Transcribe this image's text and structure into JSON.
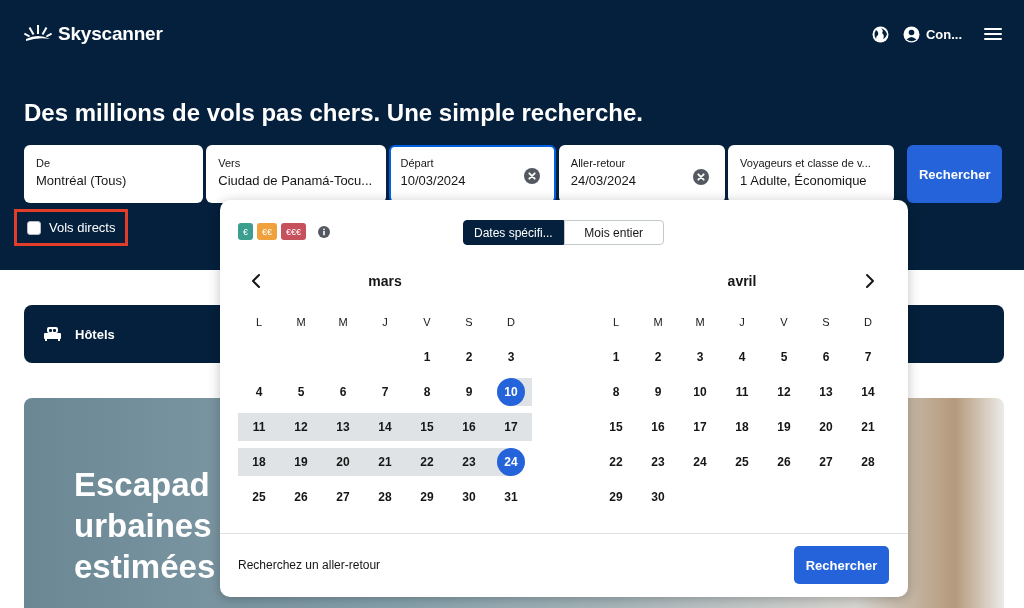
{
  "header": {
    "logo": "Skyscanner",
    "account_label": "Con...",
    "headline": "Des millions de vols pas chers. Une simple recherche."
  },
  "search_fields": [
    {
      "label": "De",
      "value": "Montréal (Tous)",
      "clearable": false,
      "focused": false
    },
    {
      "label": "Vers",
      "value": "Ciudad de Panamá-Tocu...",
      "clearable": false,
      "focused": false
    },
    {
      "label": "Départ",
      "value": "10/03/2024",
      "clearable": true,
      "focused": true
    },
    {
      "label": "Aller-retour",
      "value": "24/03/2024",
      "clearable": true,
      "focused": false
    },
    {
      "label": "Voyageurs et classe de v...",
      "value": "1 Adulte, Économique",
      "clearable": false,
      "focused": false
    }
  ],
  "search_button": "Rechercher",
  "direct_flights": {
    "label": "Vols directs",
    "checked": false,
    "highlighted": true
  },
  "date_picker": {
    "price_legend": [
      {
        "label": "€",
        "color": "#3b9e8f"
      },
      {
        "label": "€€",
        "color": "#f0a13c"
      },
      {
        "label": "€€€",
        "color": "#c7505d"
      }
    ],
    "modes": [
      {
        "label": "Dates spécifi...",
        "selected": true
      },
      {
        "label": "Mois entier",
        "selected": false
      }
    ],
    "months": [
      {
        "name": "mars",
        "prev_arrow": true,
        "next_arrow": false,
        "weekdays": [
          "L",
          "M",
          "M",
          "J",
          "V",
          "S",
          "D"
        ],
        "weeks": [
          {
            "kind": "tail",
            "days": [
              {
                "label": "1",
                "selected": false,
                "in_range": false
              },
              {
                "label": "2",
                "selected": false,
                "in_range": false
              },
              {
                "label": "3",
                "selected": false,
                "in_range": false
              }
            ]
          },
          {
            "kind": "full",
            "days": [
              {
                "label": "4",
                "selected": false,
                "in_range": false
              },
              {
                "label": "5",
                "selected": false,
                "in_range": false
              },
              {
                "label": "6",
                "selected": false,
                "in_range": false
              },
              {
                "label": "7",
                "selected": false,
                "in_range": false
              },
              {
                "label": "8",
                "selected": false,
                "in_range": false
              },
              {
                "label": "9",
                "selected": false,
                "in_range": false
              },
              {
                "label": "10",
                "selected": true,
                "in_range": false
              }
            ]
          },
          {
            "kind": "full",
            "days": [
              {
                "label": "11",
                "selected": false,
                "in_range": true
              },
              {
                "label": "12",
                "selected": false,
                "in_range": true
              },
              {
                "label": "13",
                "selected": false,
                "in_range": true
              },
              {
                "label": "14",
                "selected": false,
                "in_range": true
              },
              {
                "label": "15",
                "selected": false,
                "in_range": true
              },
              {
                "label": "16",
                "selected": false,
                "in_range": true
              },
              {
                "label": "17",
                "selected": false,
                "in_range": true
              }
            ]
          },
          {
            "kind": "full",
            "days": [
              {
                "label": "18",
                "selected": false,
                "in_range": true
              },
              {
                "label": "19",
                "selected": false,
                "in_range": true
              },
              {
                "label": "20",
                "selected": false,
                "in_range": true
              },
              {
                "label": "21",
                "selected": false,
                "in_range": true
              },
              {
                "label": "22",
                "selected": false,
                "in_range": true
              },
              {
                "label": "23",
                "selected": false,
                "in_range": true
              },
              {
                "label": "24",
                "selected": true,
                "in_range": false
              }
            ]
          },
          {
            "kind": "full",
            "days": [
              {
                "label": "25",
                "selected": false,
                "in_range": false
              },
              {
                "label": "26",
                "selected": false,
                "in_range": false
              },
              {
                "label": "27",
                "selected": false,
                "in_range": false
              },
              {
                "label": "28",
                "selected": false,
                "in_range": false
              },
              {
                "label": "29",
                "selected": false,
                "in_range": false
              },
              {
                "label": "30",
                "selected": false,
                "in_range": false
              },
              {
                "label": "31",
                "selected": false,
                "in_range": false
              }
            ]
          }
        ]
      },
      {
        "name": "avril",
        "prev_arrow": false,
        "next_arrow": true,
        "weekdays": [
          "L",
          "M",
          "M",
          "J",
          "V",
          "S",
          "D"
        ],
        "weeks": [
          {
            "kind": "full",
            "days": [
              {
                "label": "1",
                "selected": false,
                "in_range": false
              },
              {
                "label": "2",
                "selected": false,
                "in_range": false
              },
              {
                "label": "3",
                "selected": false,
                "in_range": false
              },
              {
                "label": "4",
                "selected": false,
                "in_range": false
              },
              {
                "label": "5",
                "selected": false,
                "in_range": false
              },
              {
                "label": "6",
                "selected": false,
                "in_range": false
              },
              {
                "label": "7",
                "selected": false,
                "in_range": false
              }
            ]
          },
          {
            "kind": "full",
            "days": [
              {
                "label": "8",
                "selected": false,
                "in_range": false
              },
              {
                "label": "9",
                "selected": false,
                "in_range": false
              },
              {
                "label": "10",
                "selected": false,
                "in_range": false
              },
              {
                "label": "11",
                "selected": false,
                "in_range": false
              },
              {
                "label": "12",
                "selected": false,
                "in_range": false
              },
              {
                "label": "13",
                "selected": false,
                "in_range": false
              },
              {
                "label": "14",
                "selected": false,
                "in_range": false
              }
            ]
          },
          {
            "kind": "full",
            "days": [
              {
                "label": "15",
                "selected": false,
                "in_range": false
              },
              {
                "label": "16",
                "selected": false,
                "in_range": false
              },
              {
                "label": "17",
                "selected": false,
                "in_range": false
              },
              {
                "label": "18",
                "selected": false,
                "in_range": false
              },
              {
                "label": "19",
                "selected": false,
                "in_range": false
              },
              {
                "label": "20",
                "selected": false,
                "in_range": false
              },
              {
                "label": "21",
                "selected": false,
                "in_range": false
              }
            ]
          },
          {
            "kind": "full",
            "days": [
              {
                "label": "22",
                "selected": false,
                "in_range": false
              },
              {
                "label": "23",
                "selected": false,
                "in_range": false
              },
              {
                "label": "24",
                "selected": false,
                "in_range": false
              },
              {
                "label": "25",
                "selected": false,
                "in_range": false
              },
              {
                "label": "26",
                "selected": false,
                "in_range": false
              },
              {
                "label": "27",
                "selected": false,
                "in_range": false
              },
              {
                "label": "28",
                "selected": false,
                "in_range": false
              }
            ]
          },
          {
            "kind": "head",
            "days": [
              {
                "label": "29",
                "selected": false,
                "in_range": false
              },
              {
                "label": "30",
                "selected": false,
                "in_range": false
              }
            ]
          }
        ]
      }
    ],
    "footer_text": "Recherchez un aller-retour",
    "button": "Rechercher"
  },
  "hotels_bar": {
    "label": "Hôtels"
  },
  "hero": {
    "lines": [
      "Escapad",
      "urbaines",
      "estimées"
    ]
  }
}
